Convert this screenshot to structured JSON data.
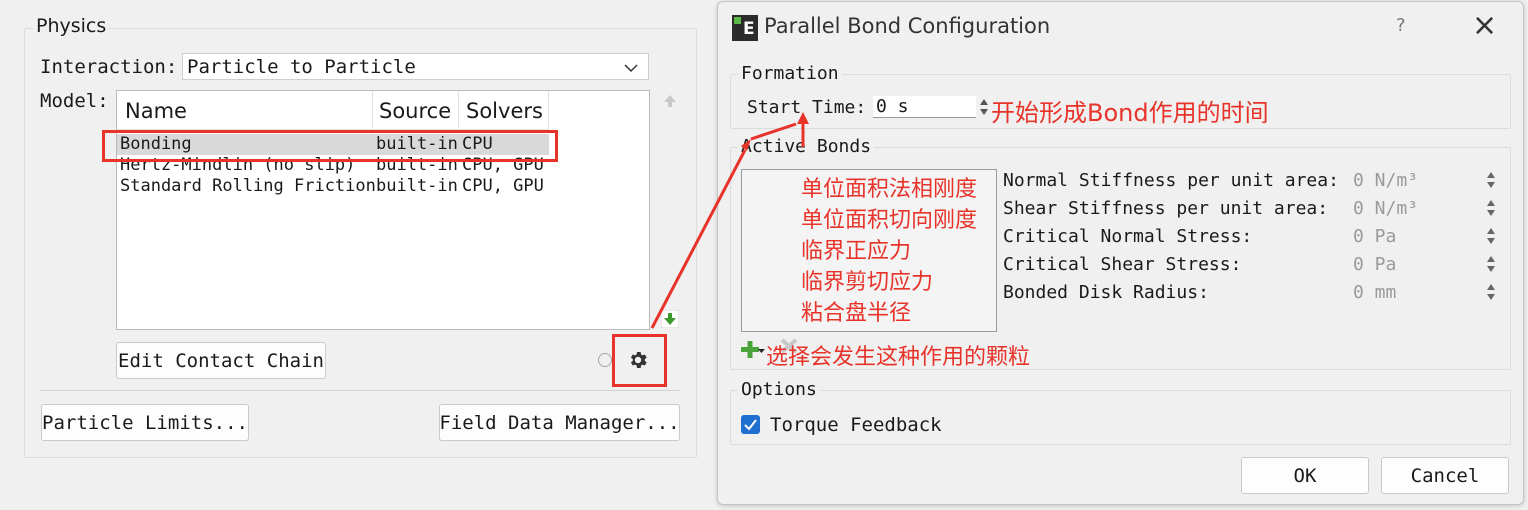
{
  "physics": {
    "title": "Physics",
    "interaction_label": "Interaction:",
    "interaction_value": "Particle to Particle",
    "model_label": "Model:",
    "columns": [
      "Name",
      "Source",
      "Solvers"
    ],
    "rows": [
      {
        "name": "Bonding",
        "source": "built-in",
        "solvers": "CPU"
      },
      {
        "name": "Hertz-Mindlin (no slip)",
        "source": "built-in",
        "solvers": "CPU, GPU"
      },
      {
        "name": "Standard Rolling Friction",
        "source": "built-in",
        "solvers": "CPU, GPU"
      }
    ],
    "edit_contact_chain": "Edit Contact Chain",
    "particle_limits": "Particle Limits...",
    "field_data_manager": "Field Data Manager..."
  },
  "dialog": {
    "title": "Parallel Bond Configuration",
    "help": "?",
    "close": "×",
    "formation_title": "Formation",
    "start_time_label": "Start Time:",
    "start_time_value": "0 s",
    "active_bonds_title": "Active Bonds",
    "fields": [
      {
        "label": "Normal Stiffness per unit area:",
        "value": "0 N/m³"
      },
      {
        "label": "Shear Stiffness per unit area:",
        "value": "0 N/m³"
      },
      {
        "label": "Critical Normal Stress:",
        "value": "0 Pa"
      },
      {
        "label": "Critical Shear Stress:",
        "value": "0 Pa"
      },
      {
        "label": "Bonded Disk Radius:",
        "value": "0 mm"
      }
    ],
    "options_title": "Options",
    "torque_feedback": "Torque Feedback",
    "ok": "OK",
    "cancel": "Cancel"
  },
  "annotations": {
    "start_time_note": "开始形成Bond作用的时间",
    "list_notes": [
      "单位面积法相刚度",
      "单位面积切向刚度",
      "临界正应力",
      "临界剪切应力",
      "粘合盘半径"
    ],
    "select_note": "选择会发生这种作用的颗粒"
  },
  "colors": {
    "annotation_red": "#e8332a",
    "checkbox_blue": "#1e6fd0",
    "selection_gray": "#d9d9d9"
  }
}
